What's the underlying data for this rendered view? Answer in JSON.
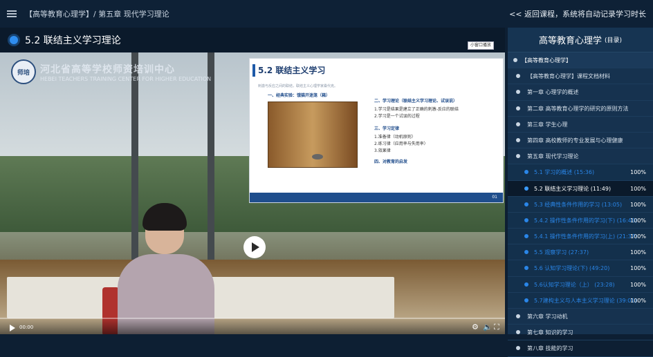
{
  "topbar": {
    "breadcrumb": "【高等教育心理学】/ 第五章 现代学习理论",
    "back_link": "<< 返回课程，系统将自动记录学习时长"
  },
  "lesson": {
    "title": "5.2 联结主义学习理论"
  },
  "video": {
    "logo_seal": "师培",
    "logo_cn": "河北省高等学校师资培训中心",
    "logo_en": "HEBEI TEACHERS TRAINING CENTER FOR HIGHER EDUCATION",
    "mini_window": "小窗口播放",
    "time": "00:00",
    "progress": 0,
    "slide": {
      "title": "5.2 联结主义学习",
      "subtitle": "刺激与反应之间的联结，联结主义心理学家桑代克。",
      "section1": "一、经典实验：饿猫开迷笼（箱）",
      "r1_head": "二、学习理论（联结主义学习理论、试误说）",
      "r1_a": "1.学习是结果是建立了正确的刺激-反应的联结",
      "r1_b": "2.学习是一个试误的过程",
      "r2_head": "三、学习定律",
      "r2_a": "1.准备律（动机原则）",
      "r2_b": "2.练习律（应用率与失用率）",
      "r2_c": "3.效果律",
      "r3_head": "四、对教育的启发",
      "page": "01"
    }
  },
  "sidebar": {
    "title": "高等教育心理学",
    "title_suffix": "(目录)",
    "items": [
      {
        "label": "【高等教育心理学】",
        "kind": "top"
      },
      {
        "label": "【高等教育心理学】课程文档材料",
        "kind": "chapter"
      },
      {
        "label": "第一章 心理学的概述",
        "kind": "chapter"
      },
      {
        "label": "第二章 高等教育心理学的研究的原则方法",
        "kind": "chapter"
      },
      {
        "label": "第三章 学生心理",
        "kind": "chapter"
      },
      {
        "label": "第四章 高校教师的专业发展与心理健康",
        "kind": "chapter"
      },
      {
        "label": "第五章 现代学习理论",
        "kind": "chapter"
      },
      {
        "label": "5.1 学习的概述 (15:36)",
        "kind": "sub",
        "pct": "100%"
      },
      {
        "label": "5.2 联结主义学习理论 (11:49)",
        "kind": "sub active",
        "pct": "100%"
      },
      {
        "label": "5.3 经典性条件作用的学习 (13:05)",
        "kind": "sub",
        "pct": "100%"
      },
      {
        "label": "5.4.2 操作性条件作用的学习(下) (16:46)",
        "kind": "sub",
        "pct": "100%"
      },
      {
        "label": "5.4.1 操作性条件作用的学习(上) (21:37)",
        "kind": "sub",
        "pct": "100%"
      },
      {
        "label": "5.5 观察学习 (27:37)",
        "kind": "sub",
        "pct": "100%"
      },
      {
        "label": "5.6 认知学习理论(下) (49:20)",
        "kind": "sub",
        "pct": "100%"
      },
      {
        "label": "5.6认知学习理论（上） (23:28)",
        "kind": "sub",
        "pct": "100%"
      },
      {
        "label": "5.7建构主义与人本主义学习理论 (39:01)",
        "kind": "sub",
        "pct": "100%"
      },
      {
        "label": "第六章 学习动机",
        "kind": "chapter"
      },
      {
        "label": "第七章 知识的学习",
        "kind": "chapter"
      },
      {
        "label": "第八章 技能的学习",
        "kind": "chapter"
      }
    ]
  }
}
